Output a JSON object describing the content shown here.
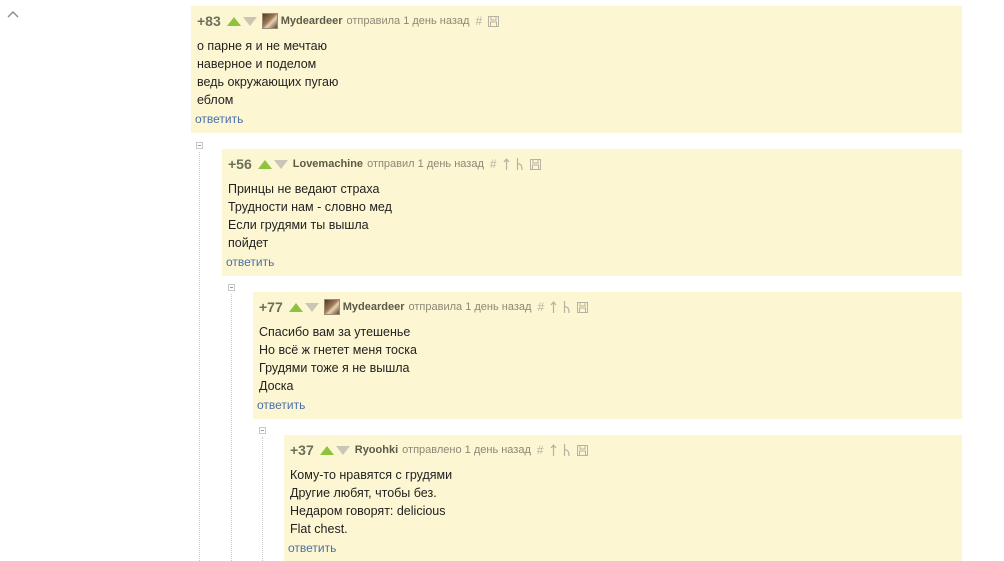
{
  "comments": [
    {
      "rating": "+83",
      "author": "Mydeardeer",
      "action": "отправила",
      "time": "1 день назад",
      "lines": [
        "о парне я и не мечтаю",
        "наверное и поделом",
        "ведь окружающих пугаю",
        "еблом"
      ],
      "reply": "ответить"
    },
    {
      "rating": "+56",
      "author": "Lovemachine",
      "action": "отправил",
      "time": "1 день назад",
      "lines": [
        "Принцы не ведают страха",
        "Трудности нам - словно мед",
        "Если грудями ты вышла",
        "пойдет"
      ],
      "reply": "ответить"
    },
    {
      "rating": "+77",
      "author": "Mydeardeer",
      "action": "отправила",
      "time": "1 день назад",
      "lines": [
        "Спасибо вам за утешенье",
        "Но всё ж гнетет меня тоска",
        "Грудями тоже я не вышла",
        "Доска"
      ],
      "reply": "ответить"
    },
    {
      "rating": "+37",
      "author": "Ryoohki",
      "action": "отправлено",
      "time": "1 день назад",
      "lines": [
        "Кому-то нравятся с грудями",
        "Другие любят, чтобы без.",
        "Недаром говорят: delicious",
        "Flat chest."
      ],
      "reply": "ответить"
    }
  ],
  "icons": {
    "collapse_all": "chevron-up-icon",
    "hash": "#",
    "up_arrow": "ꜛ",
    "branch": "ᵗ"
  },
  "colors": {
    "comment_bg": "#fdf6d2",
    "upvote": "#8ec23f",
    "downvote": "#c9c6b6",
    "reply_link": "#4a6fa8"
  }
}
